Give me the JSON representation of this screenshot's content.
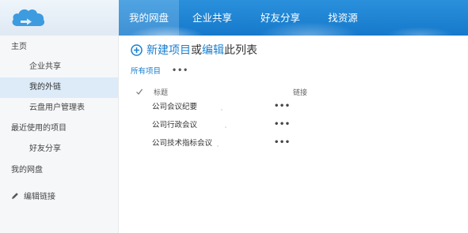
{
  "header": {
    "nav": [
      {
        "label": "我的网盘",
        "active": true
      },
      {
        "label": "企业共享",
        "active": false
      },
      {
        "label": "好友分享",
        "active": false
      },
      {
        "label": "找资源",
        "active": false
      }
    ],
    "accent_color": "#1a84d6"
  },
  "sidebar": {
    "items": [
      {
        "label": "主页",
        "level": "top"
      },
      {
        "label": "企业共享",
        "level": "sub"
      },
      {
        "label": "我的外链",
        "level": "sub",
        "active": true
      },
      {
        "label": "云盘用户管理表",
        "level": "sub"
      },
      {
        "label": "最近使用的项目",
        "level": "top"
      },
      {
        "label": "好友分享",
        "level": "sub"
      },
      {
        "label": "我的网盘",
        "level": "top"
      },
      {
        "label": "编辑链接",
        "level": "top",
        "icon": "pencil-icon"
      }
    ]
  },
  "main": {
    "new_item_link": "新建项目",
    "or_text": "或",
    "edit_link": "编辑",
    "this_list_text": "此列表",
    "view_all": "所有项目",
    "view_more": "•••",
    "columns": {
      "check": "✔",
      "title": "标题",
      "link": "链接"
    },
    "rows": [
      {
        "name": "公司会议纪要",
        "more": "•••"
      },
      {
        "name": "公司行政会议",
        "more": "•••"
      },
      {
        "name": "公司技术指标会议",
        "more": "•••"
      }
    ]
  }
}
